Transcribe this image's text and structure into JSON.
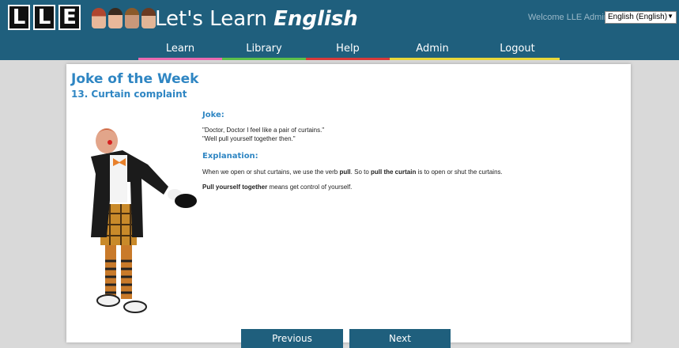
{
  "header": {
    "logo_letters": [
      "L",
      "L",
      "E"
    ],
    "title_plain": "Let's Learn ",
    "title_emph": "English",
    "welcome_text": "Welcome LLE Admin",
    "language_selected": "English (English)"
  },
  "nav": {
    "items": [
      {
        "label": "Learn",
        "color": "#e86ab0"
      },
      {
        "label": "Library",
        "color": "#5cc04a"
      },
      {
        "label": "Help",
        "color": "#d83a3a"
      },
      {
        "label": "Admin",
        "color": "#e8d83a"
      },
      {
        "label": "Logout",
        "color": "#e8d83a"
      }
    ]
  },
  "content": {
    "title": "Joke of the Week",
    "subtitle": "13. Curtain complaint",
    "joke_heading": "Joke:",
    "joke_line1": "\"Doctor, Doctor I feel like a pair of curtains.\"",
    "joke_line2": "\"Well pull yourself together then.\"",
    "explanation_heading": "Explanation:",
    "explanation_p1": {
      "t1": "When we open or shut curtains, we use the verb ",
      "b1": "pull",
      "t2": ". So to ",
      "b2": "pull the curtain",
      "t3": " is to open or shut the curtains."
    },
    "explanation_p2": {
      "b1": "Pull yourself together",
      "t1": " means get control of yourself."
    }
  },
  "buttons": {
    "previous": "Previous",
    "next": "Next"
  },
  "colors": {
    "brand": "#1f5f7d",
    "heading": "#2f86c3",
    "page_bg": "#d9d9d9"
  }
}
